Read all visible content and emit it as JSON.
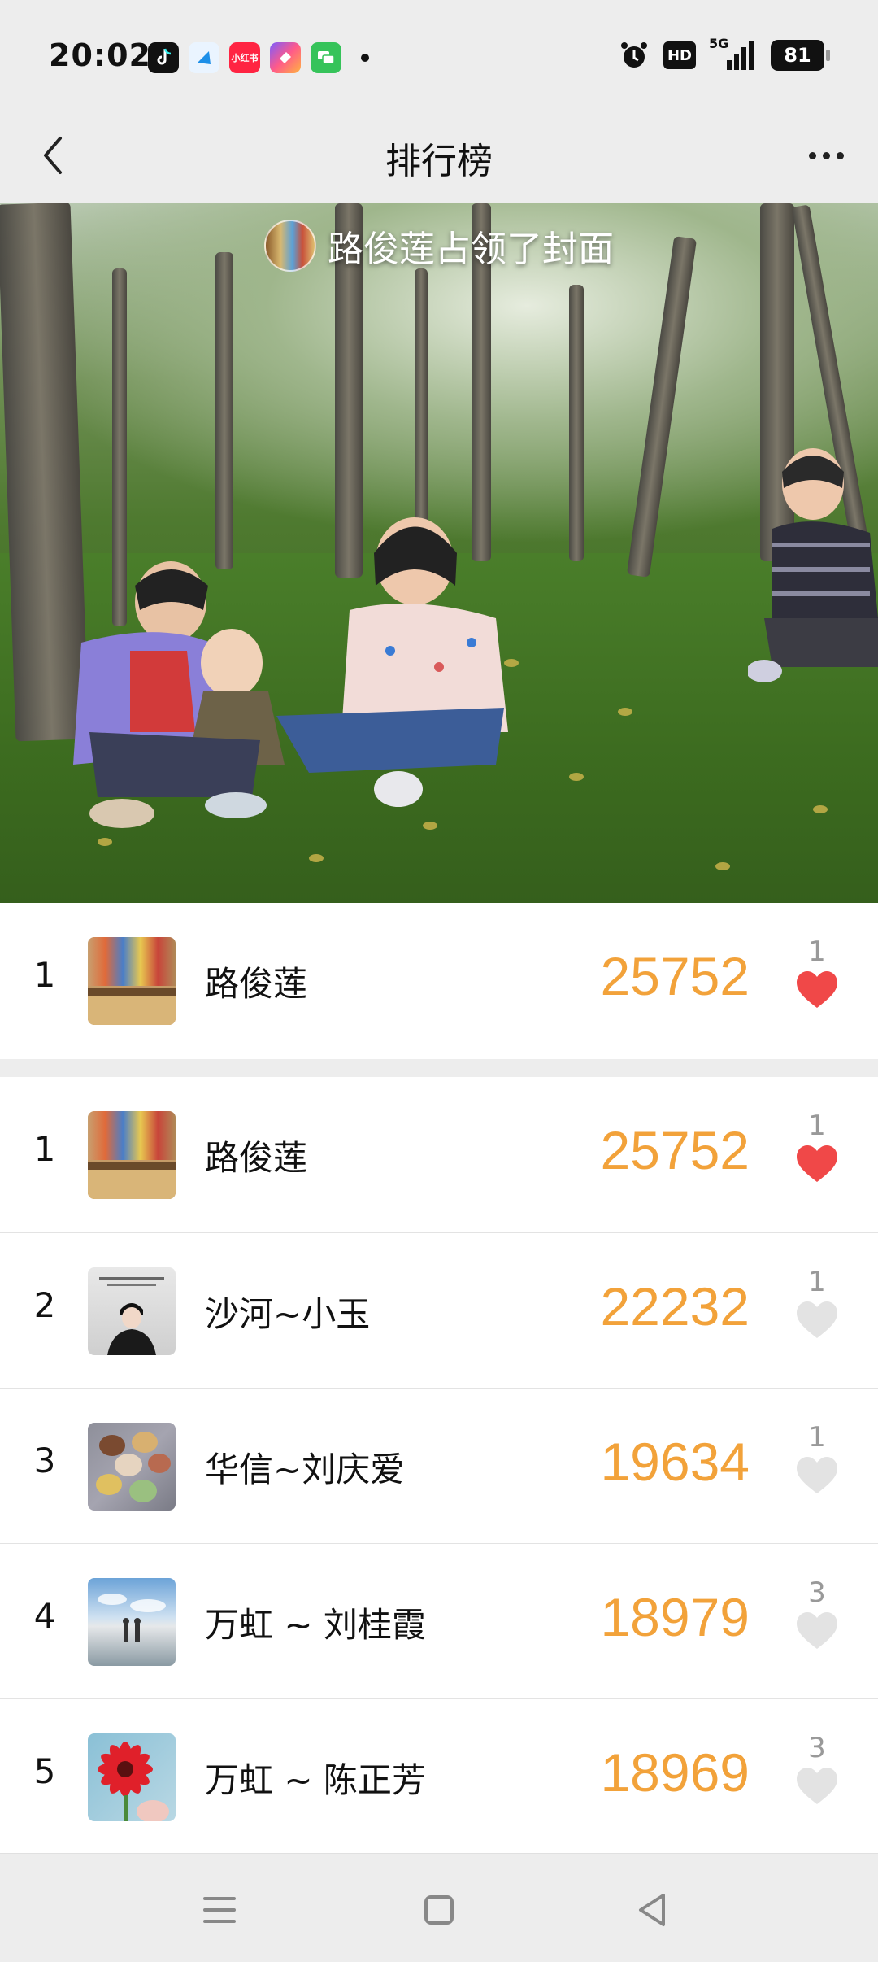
{
  "status_bar": {
    "time": "20:02",
    "apps": [
      "tiktok-icon",
      "browser-icon",
      "xiaohongshu-icon",
      "shortcut-app-icon",
      "message-app-icon"
    ],
    "xiaohongshu_label": "小红书",
    "hd": "HD",
    "network": "5G",
    "battery": "81"
  },
  "header": {
    "title": "排行榜",
    "back_icon": "chevron-left-icon",
    "more_icon": "more-horizontal-icon"
  },
  "cover": {
    "text": "路俊莲占领了封面"
  },
  "my_rank": {
    "rank": "1",
    "name": "路俊莲",
    "steps": "25752",
    "likes": "1",
    "liked": true
  },
  "ranking": [
    {
      "rank": "1",
      "name": "路俊莲",
      "steps": "25752",
      "likes": "1",
      "liked": true,
      "avatar": "shelf"
    },
    {
      "rank": "2",
      "name": "沙河~小玉",
      "steps": "22232",
      "likes": "1",
      "liked": false,
      "avatar": "woman"
    },
    {
      "rank": "3",
      "name": "华信~刘庆爱",
      "steps": "19634",
      "likes": "1",
      "liked": false,
      "avatar": "macaron"
    },
    {
      "rank": "4",
      "name": "万虹 ~ 刘桂霞",
      "steps": "18979",
      "likes": "3",
      "liked": false,
      "avatar": "beach"
    },
    {
      "rank": "5",
      "name": "万虹 ~ 陈正芳",
      "steps": "18969",
      "likes": "3",
      "liked": false,
      "avatar": "flower"
    }
  ],
  "colors": {
    "steps": "#f2a23a",
    "heart_active": "#f04848",
    "heart_inactive": "#e3e3e3",
    "background": "#ededed"
  },
  "bottom_nav": [
    "menu-icon",
    "home-square-icon",
    "back-triangle-icon"
  ]
}
